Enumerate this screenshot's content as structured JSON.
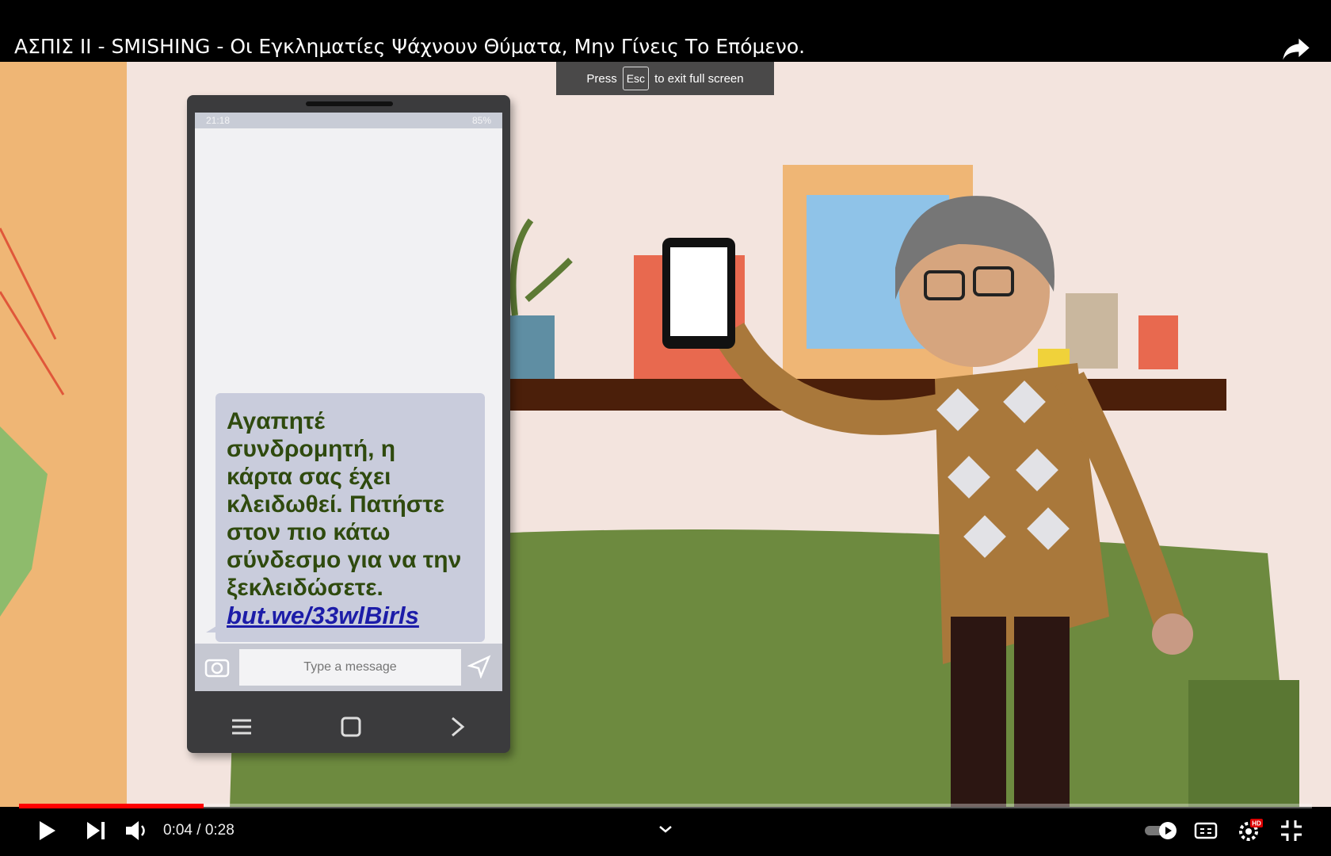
{
  "video": {
    "title": "ΑΣΠΙΣ ΙΙ - SMISHING - Οι Εγκληματίες Ψάχνουν Θύματα, Μην Γίνεις Το Επόμενο."
  },
  "fullscreen_hint": {
    "press": "Press",
    "key": "Esc",
    "rest": "to exit full screen"
  },
  "phone": {
    "status_time": "21:18",
    "battery": "85%",
    "message_lines": [
      "Αγαπητέ",
      "συνδρομητή, η",
      "κάρτα σας έχει",
      "κλειδωθεί. Πατήστε",
      "στον πιο κάτω",
      "σύνδεσμο για να την",
      "ξεκλειδώσετε."
    ],
    "message_link": "but.we/33wlBirls",
    "input_placeholder": "Type a message"
  },
  "player": {
    "time": "0:04 / 0:28",
    "progress": 0.143,
    "quality_badge": "HD"
  },
  "icons": [
    "share-icon",
    "play-icon",
    "next-icon",
    "volume-icon",
    "chevron-down-icon",
    "autoplay-toggle-icon",
    "captions-icon",
    "settings-icon",
    "exit-fullscreen-icon",
    "camera-icon",
    "send-icon",
    "menu-icon",
    "home-icon",
    "back-icon"
  ],
  "colors": {
    "progress": "#ff0000",
    "bubble_text": "#2f4a0e",
    "link": "#1c1ca8"
  }
}
